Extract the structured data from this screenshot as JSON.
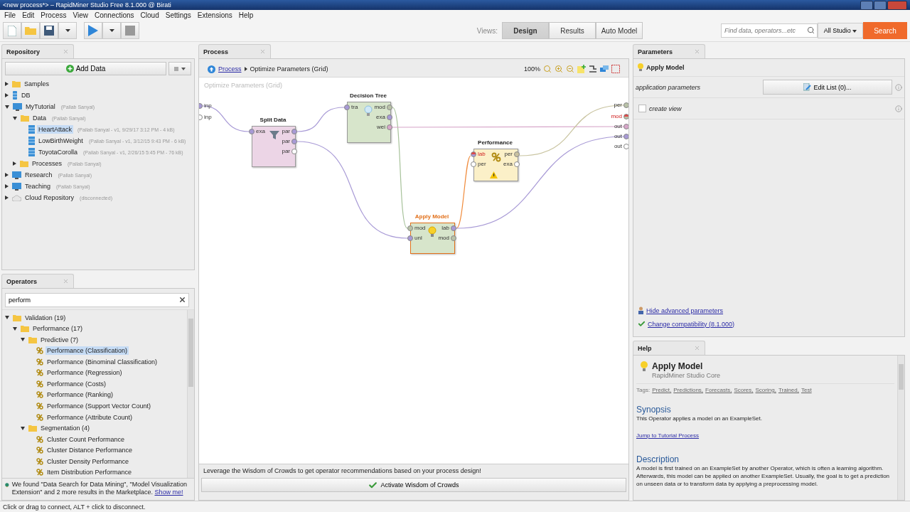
{
  "window": {
    "title": "<new process*> – RapidMiner Studio Free 8.1.000 @ Birati"
  },
  "menu": [
    "File",
    "Edit",
    "Process",
    "View",
    "Connections",
    "Cloud",
    "Settings",
    "Extensions",
    "Help"
  ],
  "toolbar": {
    "views_label": "Views:",
    "views": [
      {
        "label": "Design",
        "selected": true
      },
      {
        "label": "Results",
        "selected": false
      },
      {
        "label": "Auto Model",
        "selected": false
      }
    ],
    "search": {
      "placeholder": "Find data, operators...etc"
    },
    "scope": "All Studio",
    "search_button": "Search"
  },
  "repository": {
    "title": "Repository",
    "add_data": "Add Data",
    "tree": [
      {
        "name": "Samples",
        "kind": "folder",
        "expanded": false,
        "selected": false
      },
      {
        "name": "DB",
        "kind": "db",
        "expanded": false,
        "selected": false
      },
      {
        "name": "MyTutorial",
        "detail": "(Pallab Sanyal)",
        "kind": "computer",
        "expanded": true,
        "selected": false,
        "children": [
          {
            "name": "Data",
            "detail": "(Pallab Sanyal)",
            "kind": "folder",
            "expanded": true,
            "selected": false,
            "children": [
              {
                "name": "HeartAttack",
                "detail": "(Pallab Sanyal - v1, 9/29/17 3:12 PM - 4 kB)",
                "kind": "data",
                "selected": true
              },
              {
                "name": "LowBirthWeight",
                "detail": "(Pallab Sanyal - v1, 3/12/15 9:43 PM - 6 kB)",
                "kind": "data",
                "selected": false
              },
              {
                "name": "ToyotaCorolla",
                "detail": "(Pallab Sanyal - v1, 2/26/15 5:45 PM - 76 kB)",
                "kind": "data",
                "selected": false
              }
            ]
          },
          {
            "name": "Processes",
            "detail": "(Pallab Sanyal)",
            "kind": "folder",
            "expanded": false,
            "selected": false
          }
        ]
      },
      {
        "name": "Research",
        "detail": "(Pallab Sanyal)",
        "kind": "computer",
        "expanded": false,
        "selected": false
      },
      {
        "name": "Teaching",
        "detail": "(Pallab Sanyal)",
        "kind": "computer",
        "expanded": false,
        "selected": false
      },
      {
        "name": "Cloud Repository",
        "detail": "(disconnected)",
        "kind": "cloud",
        "expanded": false,
        "selected": false
      }
    ]
  },
  "operators": {
    "title": "Operators",
    "search": "perform",
    "tree": [
      {
        "name": "Validation (19)",
        "kind": "folder",
        "expanded": true,
        "selected": false,
        "children": [
          {
            "name": "Performance (17)",
            "kind": "folder",
            "expanded": true,
            "selected": false,
            "children": [
              {
                "name": "Predictive (7)",
                "kind": "folder",
                "expanded": true,
                "selected": false,
                "children": [
                  {
                    "name": "Performance (Classification)",
                    "kind": "operator",
                    "selected": true
                  },
                  {
                    "name": "Performance (Binominal Classification)",
                    "kind": "operator",
                    "selected": false
                  },
                  {
                    "name": "Performance (Regression)",
                    "kind": "operator",
                    "selected": false
                  },
                  {
                    "name": "Performance (Costs)",
                    "kind": "operator",
                    "selected": false
                  },
                  {
                    "name": "Performance (Ranking)",
                    "kind": "operator",
                    "selected": false
                  },
                  {
                    "name": "Performance (Support Vector Count)",
                    "kind": "operator",
                    "selected": false
                  },
                  {
                    "name": "Performance (Attribute Count)",
                    "kind": "operator",
                    "selected": false
                  }
                ]
              },
              {
                "name": "Segmentation (4)",
                "kind": "folder",
                "expanded": true,
                "selected": false,
                "children": [
                  {
                    "name": "Cluster Count Performance",
                    "kind": "operator",
                    "selected": false
                  },
                  {
                    "name": "Cluster Distance Performance",
                    "kind": "operator",
                    "selected": false
                  },
                  {
                    "name": "Cluster Density Performance",
                    "kind": "operator",
                    "selected": false
                  },
                  {
                    "name": "Item Distribution Performance",
                    "kind": "operator",
                    "selected": false
                  }
                ]
              }
            ]
          }
        ]
      }
    ],
    "marketplace": {
      "text": "We found \"Data Search for Data Mining\", \"Model Visualization Extension\" and 2 more results in the Marketplace.",
      "link": "Show me!"
    }
  },
  "process": {
    "title": "Process",
    "breadcrumb_link": "Process",
    "breadcrumb_current": "Optimize Parameters (Grid)",
    "zoom": "100%",
    "canvas_label": "Optimize Parameters (Grid)",
    "left_ports": [
      {
        "label": "inp",
        "kind": "data",
        "error": false
      },
      {
        "label": "inp",
        "kind": "empty",
        "error": false
      }
    ],
    "right_ports": [
      {
        "label": "per",
        "kind": "model",
        "error": false
      },
      {
        "label": "mod",
        "kind": "model",
        "error": true
      },
      {
        "label": "out",
        "kind": "weights",
        "error": false
      },
      {
        "label": "out",
        "kind": "data",
        "error": false
      },
      {
        "label": "out",
        "kind": "empty",
        "error": false
      }
    ],
    "nodes": [
      {
        "name": "Split Data",
        "kind": "split",
        "color": "#ecd5e6",
        "selected": false,
        "warning": false,
        "inputs": [
          {
            "label": "exa",
            "kind": "data",
            "error": false
          }
        ],
        "outputs": [
          {
            "label": "par",
            "kind": "data",
            "error": false
          },
          {
            "label": "par",
            "kind": "data",
            "error": false
          },
          {
            "label": "par",
            "kind": "empty",
            "error": false
          }
        ]
      },
      {
        "name": "Decision Tree",
        "kind": "learner",
        "color": "#d7e5cb",
        "selected": false,
        "warning": false,
        "inputs": [
          {
            "label": "tra",
            "kind": "data",
            "error": false
          }
        ],
        "outputs": [
          {
            "label": "mod",
            "kind": "model",
            "error": false
          },
          {
            "label": "exa",
            "kind": "data",
            "error": false
          },
          {
            "label": "wei",
            "kind": "weights",
            "error": false
          }
        ]
      },
      {
        "name": "Performance",
        "kind": "performance",
        "color": "#fbf0c8",
        "selected": false,
        "warning": true,
        "inputs": [
          {
            "label": "lab",
            "kind": "data",
            "error": true
          },
          {
            "label": "per",
            "kind": "empty",
            "error": false
          }
        ],
        "outputs": [
          {
            "label": "per",
            "kind": "perf",
            "error": false
          },
          {
            "label": "exa",
            "kind": "empty",
            "error": false
          }
        ]
      },
      {
        "name": "Apply Model",
        "kind": "apply",
        "color": "#d7e5cb",
        "selected": true,
        "warning": false,
        "inputs": [
          {
            "label": "mod",
            "kind": "model",
            "error": false
          },
          {
            "label": "unl",
            "kind": "data",
            "error": false
          }
        ],
        "outputs": [
          {
            "label": "lab",
            "kind": "data",
            "error": false
          },
          {
            "label": "mod",
            "kind": "model",
            "error": false
          }
        ]
      }
    ],
    "wisdom_text": "Leverage the Wisdom of Crowds to get operator recommendations based on your process design!",
    "wisdom_button": "Activate Wisdom of Crowds"
  },
  "parameters": {
    "title": "Parameters",
    "operator": "Apply Model",
    "params": [
      {
        "kind": "list",
        "label": "application parameters",
        "button": "Edit List (0)..."
      },
      {
        "kind": "checkbox",
        "label": "create view",
        "checked": false
      }
    ],
    "links": [
      {
        "kind": "advanced",
        "label": "Hide advanced parameters"
      },
      {
        "kind": "compat",
        "label": "Change compatibility (8.1.000)"
      }
    ]
  },
  "help": {
    "title": "Help",
    "operator": "Apply Model",
    "subtitle": "RapidMiner Studio Core",
    "tags_label": "Tags:",
    "tags": [
      "Predict,",
      "Predictions,",
      "Forecasts,",
      "Scores,",
      "Scoring,",
      "Trained,",
      "Test"
    ],
    "sections": [
      {
        "heading": "Synopsis",
        "text": "This Operator applies a model on an ExampleSet.",
        "link": "Jump to Tutorial Process"
      },
      {
        "heading": "Description",
        "text": "A model is first trained on an ExampleSet by another Operator, which is often a learning algorithm. Afterwards, this model can be applied on another ExampleSet. Usually, the goal is to get a prediction on unseen data or to transform data by applying a preprocessing model."
      }
    ]
  },
  "status_bar": "Click or drag to connect, ALT + click to disconnect."
}
